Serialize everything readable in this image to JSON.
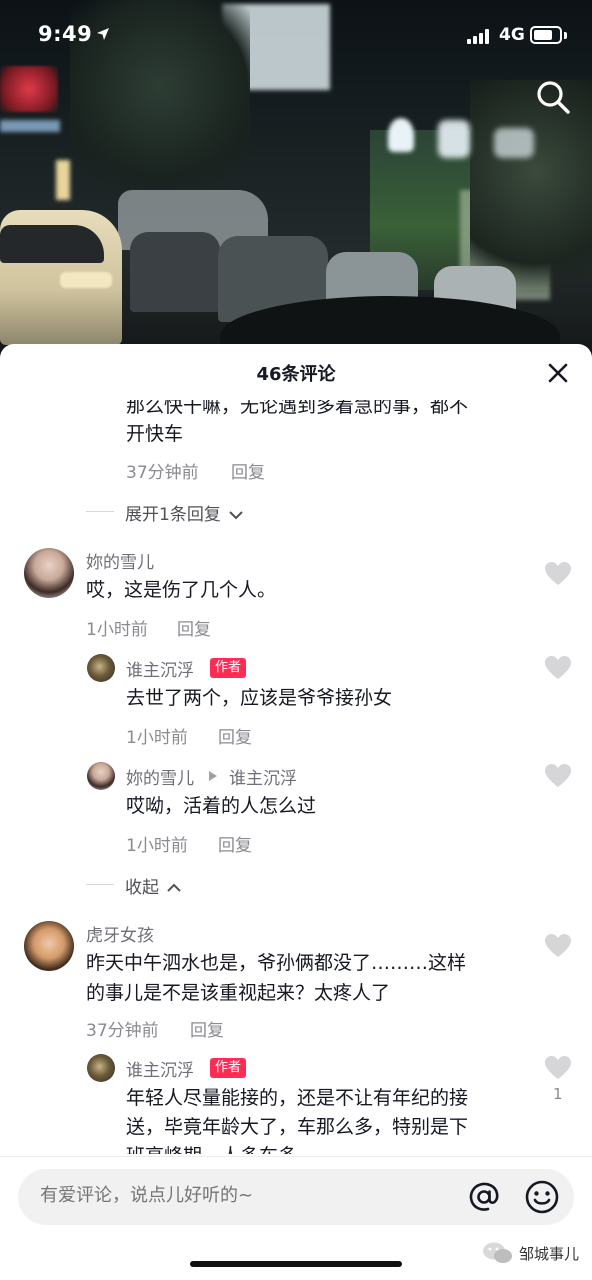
{
  "status_bar": {
    "time": "9:49",
    "network": "4G"
  },
  "sheet": {
    "title": "46条评论",
    "comments": [
      {
        "partial_text_1": "那么快干嘛，无论遇到多着急的事，都不",
        "partial_text_2": "开快车",
        "time": "37分钟前",
        "reply_label": "回复",
        "expand_label": "展开1条回复"
      },
      {
        "user": "妳的雪儿",
        "text": "哎，这是伤了几个人。",
        "time": "1小时前",
        "reply_label": "回复",
        "replies": [
          {
            "user": "谁主沉浮",
            "tag": "作者",
            "text": "去世了两个，应该是爷爷接孙女",
            "time": "1小时前",
            "reply_label": "回复"
          },
          {
            "user": "妳的雪儿",
            "reply_to": "谁主沉浮",
            "text": "哎呦，活着的人怎么过",
            "time": "1小时前",
            "reply_label": "回复"
          }
        ],
        "collapse_label": "收起"
      },
      {
        "user": "虎牙女孩",
        "text_line_1": "昨天中午泗水也是，爷孙俩都没了………这样",
        "text_line_2": "的事儿是不是该重视起来？太疼人了",
        "time": "37分钟前",
        "reply_label": "回复",
        "replies": [
          {
            "user": "谁主沉浮",
            "tag": "作者",
            "text_line_1": "年轻人尽量能接的，还是不让有年纪的接",
            "text_line_2": "送，毕竟年龄大了，车那么多，特别是下",
            "text_line_3": "班高峰期，人多车多",
            "likes": "1"
          }
        ]
      }
    ]
  },
  "input_bar": {
    "placeholder": "有爱评论，说点儿好听的~"
  },
  "watermark": {
    "text": "邹城事儿"
  },
  "colors": {
    "author_tag": "#fe2c55",
    "heart": "#d6d6d8",
    "text": "#161823",
    "meta": "#8a8b91"
  }
}
